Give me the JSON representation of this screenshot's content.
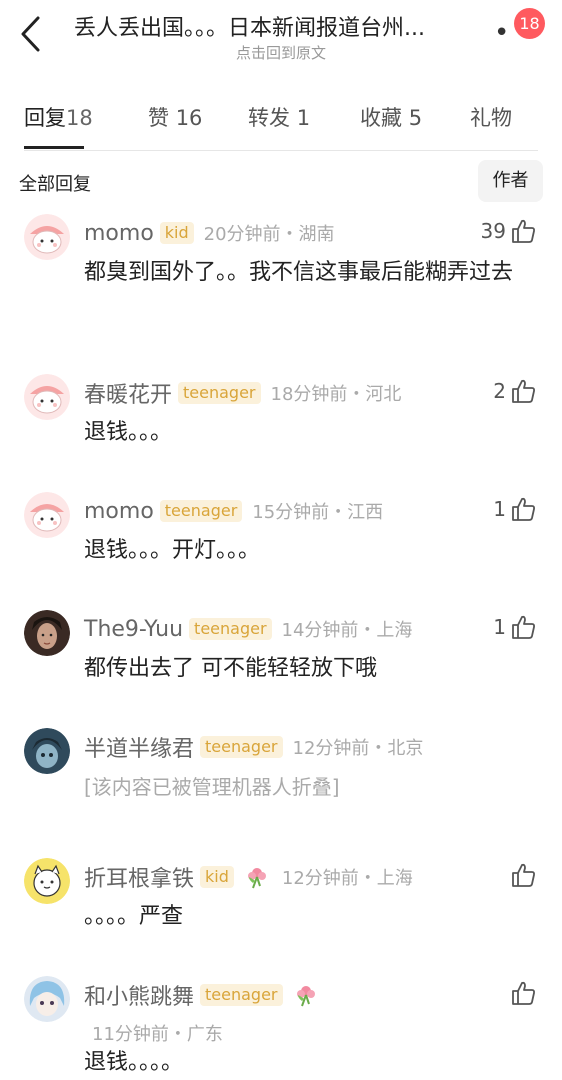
{
  "header": {
    "title": "丢人丢出国。。。日本新闻报道台州...",
    "subtitle": "点击回到原文",
    "more_label": "• •",
    "badge": "18"
  },
  "tabs": [
    {
      "label": "回复",
      "count": "18"
    },
    {
      "label": "赞",
      "count": "16"
    },
    {
      "label": "转发",
      "count": "1"
    },
    {
      "label": "收藏",
      "count": "5"
    },
    {
      "label": "礼物",
      "count": ""
    }
  ],
  "filter": {
    "all_label": "全部回复",
    "author_label": "作者"
  },
  "comments": [
    {
      "name": "momo",
      "tag": "kid",
      "time": "20分钟前・湖南",
      "likes": "39",
      "text": "都臭到国外了。。我不信这事最后能糊弄过去"
    },
    {
      "name": "春暖花开",
      "tag": "teenager",
      "time": "18分钟前・河北",
      "likes": "2",
      "text": "退钱。。。"
    },
    {
      "name": "momo",
      "tag": "teenager",
      "time": "15分钟前・江西",
      "likes": "1",
      "text": "退钱。。。开灯。。。"
    },
    {
      "name": "The9-Yuu",
      "tag": "teenager",
      "time": "14分钟前・上海",
      "likes": "1",
      "text": "都传出去了 可不能轻轻放下哦"
    },
    {
      "name": "半道半缘君",
      "tag": "teenager",
      "time": "12分钟前・北京",
      "likes": "",
      "text": "[该内容已被管理机器人折叠]"
    },
    {
      "name": "折耳根拿铁",
      "tag": "kid",
      "time": "12分钟前・上海",
      "likes": "",
      "text": "。。。。严查"
    },
    {
      "name": "和小熊跳舞",
      "tag": "teenager",
      "time": "11分钟前・广东",
      "likes": "",
      "text": "退钱。。。。"
    }
  ],
  "colors": {
    "accent": "#ff5a5f",
    "tag_text": "#d9a53a",
    "tag_bg": "#fbf1db"
  }
}
